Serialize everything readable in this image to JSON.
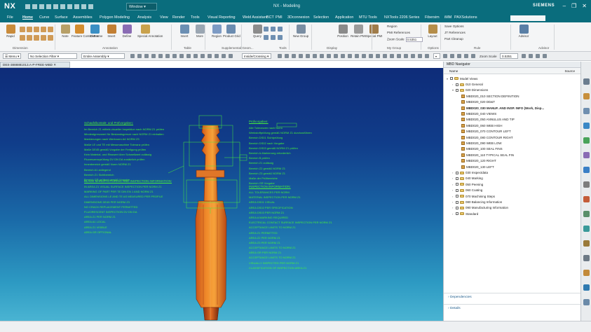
{
  "app": {
    "logo": "NX",
    "window_menu": "Window",
    "title": "NX - Modeling",
    "brand": "SIEMENS"
  },
  "menu_tabs": [
    "File",
    "Home",
    "Curve",
    "Surface",
    "Assemblies",
    "Polygon Modeling",
    "Analysis",
    "View",
    "Render",
    "Tools",
    "Visual Reporting",
    "Weld Assistant",
    "BCT",
    "PMI",
    "3Dconnexion",
    "Selection",
    "Application",
    "MTU Tools",
    "NXTools 2206 Series",
    "Fibersim",
    "iMM",
    "PAXSolutions"
  ],
  "ribbon": {
    "buttons": [
      {
        "label": "Rapid",
        "color": "#c98b3b"
      },
      {
        "label": "Note",
        "color": "#b7a068"
      },
      {
        "label": "Feature Control Frame",
        "color": "#d48d2f"
      },
      {
        "label": "Datum",
        "color": "#3b8fc4"
      },
      {
        "label": "Insert",
        "color": "#c27f34"
      },
      {
        "label": "Define",
        "color": "#8a6cb4"
      },
      {
        "label": "Special Annotation",
        "color": "#c9a24d"
      },
      {
        "label": "Insert",
        "color": "#6b8fb3"
      },
      {
        "label": "More",
        "color": "#9aa6b2"
      },
      {
        "label": "Region",
        "color": "#7d9bc4"
      },
      {
        "label": "Product Grid",
        "color": "#6b8cb0"
      },
      {
        "label": "Query",
        "color": "#8c8c8c"
      },
      {
        "label": "New Group",
        "color": "#7a8ea3"
      },
      {
        "label": "Position",
        "color": "#8a8a8a"
      },
      {
        "label": "Retain PMI",
        "color": "#9b9b9b"
      },
      {
        "label": "Special PMI",
        "color": "#a07c4a"
      },
      {
        "label": "Layout",
        "color": "#b58e4a"
      },
      {
        "label": "Advisor",
        "color": "#5a7fa6"
      }
    ],
    "groups": [
      "Dimension",
      "Annotation",
      "Table",
      "Supplemental Geom...",
      "Tools",
      "Display",
      "My Group",
      "Options",
      "Rule",
      "Advisor"
    ],
    "options_items": [
      "Save Options",
      "JT References",
      "Part Cleanup"
    ],
    "mygroup_items": [
      "Region",
      "PMI References",
      "Zoom Scale"
    ],
    "zoom_scale": "0.5351"
  },
  "toolbar": {
    "menu_label": "Menu",
    "selection_filter": "No Selection Filter",
    "assembly_scope": "Entire Assembly",
    "select_mode": "Inside/Crossing",
    "zoom_label": "Zoom Scale",
    "zoom_value": "0.5351"
  },
  "document_tab": "DES-3888881013.A-P-FREE-MBD",
  "notes": {
    "left_head_1": "Schaufelkontakt- und Prüfvorgaben:",
    "left_lines_1": [
      "Im Bereich Z1 mittels visueller Inspektion nach NORM Z1 prüfen",
      "Mindestgrenzwert für Bestandsgrenze nach NORM Z1 einhalten",
      "Markierungen nach Werknorm A4 NORM Z3",
      "Maße LE und TE mit Messmaschine Toleranz prüfen",
      "Maße DE45 gemäß Vorgabe der Fertigung prüfen",
      "Kein Material- und Risswert über Schwellwert zulässig",
      "Fluoreszenzprüfung DV DN DA zusätzlich prüfen",
      "Innenbereich gemäß Norm NORM Z1",
      "Bereich A1 anliegend",
      "Bereich Z1 Sichtbereich",
      "Bereich GR prüfend gemäß Vorgabe"
    ],
    "left_head_2": "BLADE MANUFACTURING AND INSPECTION INFORMATION:",
    "left_lines_2": [
      "IN AREA Z1 VISUAL SURFACE INSPECTION PER NORM Z1",
      "MARKING OF PART PER TE DIN EN 1 AND NORM Z1",
      "ALL DIMENSIONS LE AND TE AS MEASURED PER PROFILE",
      "DIMENSIONS DE45 PER NORM Z3",
      "NO CRACK REPLACEMENT PERMITTED",
      "FLUORESCENT INSPECTION DV DN DA",
      "AREA Z1 PER NORM Z1",
      "AREA A1 LOCAL",
      "AREA Z1 VISIBLE",
      "AREA GR OPTIONAL"
    ],
    "right_head_1": "Prüfvorgaben:",
    "right_lines_1": [
      "Alle Toleranzen nach Norm",
      "Werkstoffprüfung gemäß NORM Z1 durchzuführen",
      "Bereich DS01 Sichtprüfung",
      "Bereich DS02 nach Vorgabe",
      "Bereich DS03 gemäß NORM Z1 prüfen",
      "Bereich A-Markierung erforderlich",
      "Bereich B prüfen",
      "Bereich Z1 zulässig",
      "Bereich Z2 gemäß NORM Z1",
      "Bereich Z3 gemäß NORM Z1",
      "Maße der Prüfbereiche",
      "Bereich GR Vorgabe"
    ],
    "right_head_2": "INSPECTION INFORMATION:",
    "right_lines_2": [
      "ALL TOLERANCES PER NORM",
      "MATERIAL INSPECTION PER NORM Z1",
      "AREA DS01 VISUAL",
      "AREA DS02 PER SPECIFICATION",
      "AREA DS03 PER NORM Z1",
      "AREA A MARKING REQUIRED",
      "ELECTRICAL CONTACT SURFACE INSPECTION PER NORM Z1",
      "ACCEPTANCE LIMITS TO NORM Z1",
      "AREA Z1 PERMITTED",
      "AREA Z2 PER NORM Z1",
      "AREA Z3 PER NORM Z1",
      "ACCEPTANCE LIMITS TO NORM Z1",
      "AREA GR PER NORM Z1",
      "ACCEPTANCE LIMITS TO NORM Z1",
      "VISUALLY INSPECTED PER NORM Z1",
      "CLASSIFICATION OF INSPECTION AREA Z1"
    ]
  },
  "navigator": {
    "title": "MBD Navigator",
    "col_name": "Name",
    "col_source": "Source",
    "nodes": [
      {
        "label": "Model Views",
        "level": 0,
        "kind": "check",
        "bold": false
      },
      {
        "label": "010 General",
        "level": 1,
        "kind": "folder",
        "bold": false
      },
      {
        "label": "020 Dimensions",
        "level": 1,
        "kind": "folder",
        "bold": false
      },
      {
        "label": "MBD020_010 SECTION DEFINITION",
        "level": 2,
        "kind": "view",
        "bold": false
      },
      {
        "label": "MBD020_020 DD&T",
        "level": 2,
        "kind": "view",
        "bold": false
      },
      {
        "label": "MBD020_030 MANUF. AND INSP. INFO (Work, Disp...",
        "level": 2,
        "kind": "view",
        "bold": true
      },
      {
        "label": "MBD020_040 VIEWS",
        "level": 2,
        "kind": "view",
        "bold": false
      },
      {
        "label": "MBD020_050 ANNULUS AND TIP",
        "level": 2,
        "kind": "view",
        "bold": false
      },
      {
        "label": "MBD020_060 WEB HIGH",
        "level": 2,
        "kind": "view",
        "bold": false
      },
      {
        "label": "MBD020_070 CONTOUR LEFT",
        "level": 2,
        "kind": "view",
        "bold": false
      },
      {
        "label": "MBD020_080 CONTOUR RIGHT",
        "level": 2,
        "kind": "view",
        "bold": false
      },
      {
        "label": "MBD020_090 WEB LOW",
        "level": 2,
        "kind": "view",
        "bold": false
      },
      {
        "label": "MBD020_100 SEAL FINS",
        "level": 2,
        "kind": "view",
        "bold": false
      },
      {
        "label": "MBD020_110 TYPICAL SEAL FIN",
        "level": 2,
        "kind": "view",
        "bold": false
      },
      {
        "label": "MBD020_120 RIGHT",
        "level": 2,
        "kind": "view",
        "bold": false
      },
      {
        "label": "MBD020_130 LEFT",
        "level": 2,
        "kind": "view",
        "bold": false
      },
      {
        "label": "030 Inspectdata",
        "level": 1,
        "kind": "folder",
        "bold": false
      },
      {
        "label": "040 Marking",
        "level": 1,
        "kind": "folder",
        "bold": false
      },
      {
        "label": "050 Peening",
        "level": 1,
        "kind": "folder",
        "bold": false
      },
      {
        "label": "060 Coating",
        "level": 1,
        "kind": "folder",
        "bold": false
      },
      {
        "label": "070 Machining Steps",
        "level": 1,
        "kind": "folder",
        "bold": false
      },
      {
        "label": "080 Balancing Information",
        "level": 1,
        "kind": "folder",
        "bold": false
      },
      {
        "label": "090 Manufacturing Information",
        "level": 1,
        "kind": "folder",
        "bold": false
      },
      {
        "label": "Standard",
        "level": 1,
        "kind": "check",
        "bold": false
      }
    ],
    "sections": [
      "Dependencies",
      "Details"
    ]
  },
  "resource_icons": [
    {
      "name": "part-navigator-icon",
      "color": "#6b7d8f"
    },
    {
      "name": "assembly-navigator-icon",
      "color": "#c78f3c"
    },
    {
      "name": "constraint-navigator-icon",
      "color": "#6f8fb0"
    },
    {
      "name": "mbd-navigator-icon",
      "color": "#3a88c6"
    },
    {
      "name": "reuse-library-icon",
      "color": "#4aa35a"
    },
    {
      "name": "hd3d-tools-icon",
      "color": "#8a6cb4"
    },
    {
      "name": "web-browser-icon",
      "color": "#3a7fc6"
    },
    {
      "name": "history-icon",
      "color": "#7d7d7d"
    },
    {
      "name": "process-studio-icon",
      "color": "#c45d3a"
    },
    {
      "name": "roles-icon",
      "color": "#5a8f6a"
    },
    {
      "name": "system-materials-icon",
      "color": "#3a9a9a"
    },
    {
      "name": "manufacturing-wizard-icon",
      "color": "#9a7a3a"
    },
    {
      "name": "clock-icon",
      "color": "#6d7a86"
    },
    {
      "name": "palette-icon",
      "color": "#c28a3a"
    },
    {
      "name": "teamcenter-icon",
      "color": "#2f7ab0"
    },
    {
      "name": "help-icon",
      "color": "#6a8aa8"
    }
  ]
}
